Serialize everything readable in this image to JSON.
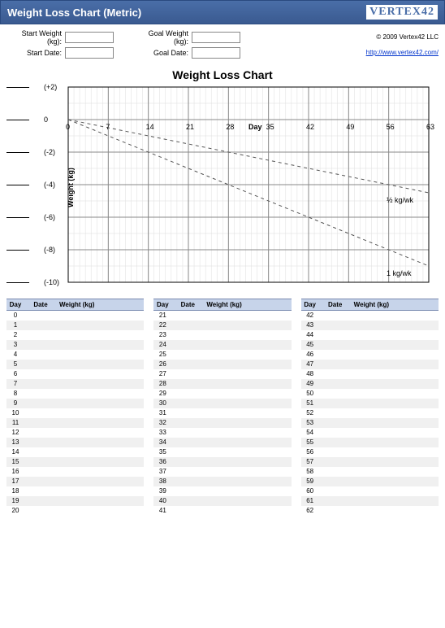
{
  "title_bar": {
    "text": "Weight Loss Chart (Metric)",
    "logo_text": "VERTEX42"
  },
  "header": {
    "start_weight_label": "Start Weight (kg):",
    "start_date_label": "Start Date:",
    "goal_weight_label": "Goal Weight (kg):",
    "goal_date_label": "Goal Date:",
    "start_weight_value": "",
    "start_date_value": "",
    "goal_weight_value": "",
    "goal_date_value": "",
    "copyright": "© 2009 Vertex42 LLC",
    "url_text": "http://www.vertex42.com/"
  },
  "chart_data": {
    "type": "line",
    "title": "Weight Loss Chart",
    "xlabel": "Day",
    "ylabel": "Weight (kg)",
    "xlim": [
      0,
      63
    ],
    "ylim": [
      -10,
      2
    ],
    "x_ticks": [
      0,
      7,
      14,
      21,
      28,
      35,
      42,
      49,
      56,
      63
    ],
    "y_ticks": [
      2,
      0,
      -2,
      -4,
      -6,
      -8,
      -10
    ],
    "y_tick_labels": [
      "(+2)",
      "0",
      "(-2)",
      "(-4)",
      "(-6)",
      "(-8)",
      "(-10)"
    ],
    "series": [
      {
        "name": "½ kg/wk",
        "x": [
          0,
          63
        ],
        "y": [
          0,
          -4.5
        ]
      },
      {
        "name": "1 kg/wk",
        "x": [
          0,
          63
        ],
        "y": [
          0,
          -9
        ]
      }
    ]
  },
  "tables": {
    "headers": {
      "day": "Day",
      "date": "Date",
      "weight": "Weight (kg)"
    },
    "columns": [
      {
        "start": 0,
        "end": 20
      },
      {
        "start": 21,
        "end": 41
      },
      {
        "start": 42,
        "end": 62
      }
    ]
  }
}
